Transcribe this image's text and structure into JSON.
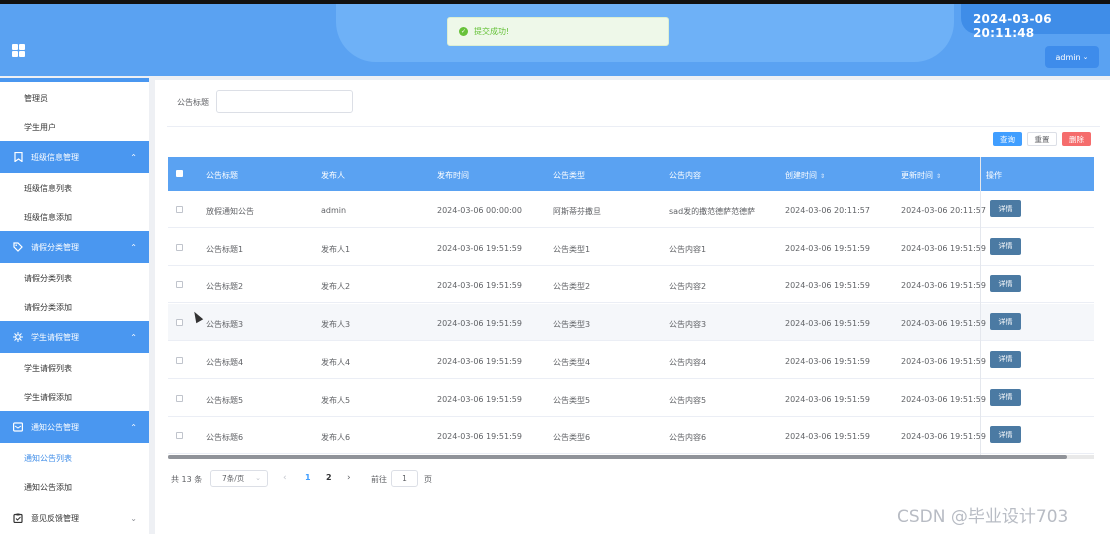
{
  "header": {
    "datetime": "2024-03-06 20:11:48",
    "user": "admin",
    "user_caret": "⌄"
  },
  "toast": {
    "text": "提交成功!",
    "icon": "✓"
  },
  "sidebar": {
    "items": [
      {
        "label": "管理员"
      },
      {
        "label": "学生用户"
      }
    ],
    "groups": [
      {
        "label": "班级信息管理",
        "icon": "bookmark-icon",
        "chev": "⌃",
        "children": [
          {
            "label": "班级信息列表"
          },
          {
            "label": "班级信息添加"
          }
        ]
      },
      {
        "label": "请假分类管理",
        "icon": "tag-icon",
        "chev": "⌃",
        "children": [
          {
            "label": "请假分类列表"
          },
          {
            "label": "请假分类添加"
          }
        ]
      },
      {
        "label": "学生请假管理",
        "icon": "gear-icon",
        "chev": "⌃",
        "children": [
          {
            "label": "学生请假列表"
          },
          {
            "label": "学生请假添加"
          }
        ]
      },
      {
        "label": "通知公告管理",
        "icon": "message-icon",
        "chev": "⌃",
        "children": [
          {
            "label": "通知公告列表"
          },
          {
            "label": "通知公告添加"
          }
        ]
      },
      {
        "label": "意见反馈管理",
        "icon": "clipboard-icon",
        "chev": "⌄"
      }
    ]
  },
  "search": {
    "label": "公告标题",
    "value": ""
  },
  "toolbar": {
    "query": "查询",
    "reset": "重置",
    "delete": "删除"
  },
  "table": {
    "columns": [
      "公告标题",
      "发布人",
      "发布时间",
      "公告类型",
      "公告内容",
      "创建时间",
      "更新时间",
      "操作"
    ],
    "sort_icon": "⇕",
    "detail_label": "详情",
    "rows": [
      [
        "放假通知公告",
        "admin",
        "2024-03-06 00:00:00",
        "阿斯蒂芬撒旦",
        "sad发的撒范德萨范德萨",
        "2024-03-06 20:11:57",
        "2024-03-06 20:11:57"
      ],
      [
        "公告标题1",
        "发布人1",
        "2024-03-06 19:51:59",
        "公告类型1",
        "公告内容1",
        "2024-03-06 19:51:59",
        "2024-03-06 19:51:59"
      ],
      [
        "公告标题2",
        "发布人2",
        "2024-03-06 19:51:59",
        "公告类型2",
        "公告内容2",
        "2024-03-06 19:51:59",
        "2024-03-06 19:51:59"
      ],
      [
        "公告标题3",
        "发布人3",
        "2024-03-06 19:51:59",
        "公告类型3",
        "公告内容3",
        "2024-03-06 19:51:59",
        "2024-03-06 19:51:59"
      ],
      [
        "公告标题4",
        "发布人4",
        "2024-03-06 19:51:59",
        "公告类型4",
        "公告内容4",
        "2024-03-06 19:51:59",
        "2024-03-06 19:51:59"
      ],
      [
        "公告标题5",
        "发布人5",
        "2024-03-06 19:51:59",
        "公告类型5",
        "公告内容5",
        "2024-03-06 19:51:59",
        "2024-03-06 19:51:59"
      ],
      [
        "公告标题6",
        "发布人6",
        "2024-03-06 19:51:59",
        "公告类型6",
        "公告内容6",
        "2024-03-06 19:51:59",
        "2024-03-06 19:51:59"
      ]
    ]
  },
  "pagination": {
    "total": "共 13 条",
    "page_size": "7条/页",
    "size_caret": "⌄",
    "prev": "‹",
    "pages": [
      "1",
      "2"
    ],
    "current": "1",
    "next": "›",
    "goto_label": "前往",
    "goto_value": "1",
    "page_suffix": "页"
  },
  "watermark": "CSDN @毕业设计703",
  "colors": {
    "primary": "#409eff",
    "header": "#5aa2f2",
    "danger": "#f56c6c",
    "success": "#67c23a"
  }
}
